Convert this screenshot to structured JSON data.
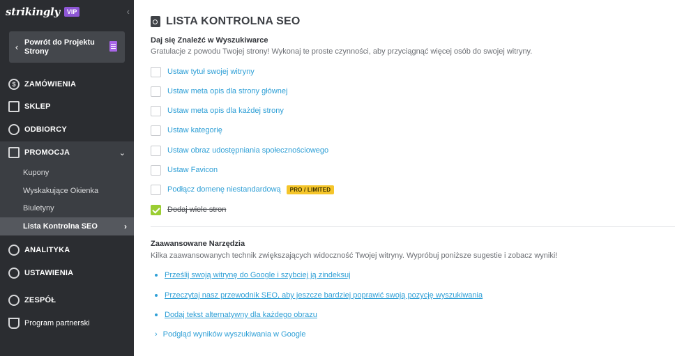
{
  "sidebar": {
    "logo": "strikingly",
    "vip": "VIP",
    "collapse_icon": "chevron-left-icon",
    "back_button": "Powrót do Projektu Strony",
    "nav": {
      "orders": "ZAMÓWIENIA",
      "store": "SKLEP",
      "audience": "ODBIORCY",
      "promotion": "PROMOCJA",
      "analytics": "ANALITYKA",
      "settings": "USTAWIENIA",
      "team": "ZESPÓŁ",
      "partner": "Program partnerski"
    },
    "sub": {
      "coupons": "Kupony",
      "popups": "Wyskakujące Okienka",
      "newsletters": "Biuletyny",
      "seo": "Lista Kontrolna SEO"
    }
  },
  "main": {
    "title": "LISTA KONTROLNA SEO",
    "section1": {
      "title": "Daj się Znaleźć w Wyszukiwarce",
      "desc": "Gratulacje z powodu Twojej strony! Wykonaj te proste czynności, aby przyciągnąć więcej osób do swojej witryny.",
      "items": [
        {
          "label": "Ustaw tytuł swojej witryny",
          "checked": false
        },
        {
          "label": "Ustaw meta opis dla strony głównej",
          "checked": false
        },
        {
          "label": "Ustaw meta opis dla każdej strony",
          "checked": false
        },
        {
          "label": "Ustaw kategorię",
          "checked": false
        },
        {
          "label": "Ustaw obraz udostępniania społecznościowego",
          "checked": false
        },
        {
          "label": "Ustaw Favicon",
          "checked": false
        },
        {
          "label": "Podłącz domenę niestandardową",
          "checked": false,
          "badge": "PRO / LIMITED"
        },
        {
          "label": "Dodaj wiele stron",
          "checked": true
        }
      ]
    },
    "section2": {
      "title": "Zaawansowane Narzędzia",
      "desc": "Kilka zaawansowanych technik zwiększających widoczność Twojej witryny. Wypróbuj poniższe sugestie i zobacz wyniki!",
      "links": [
        "Prześlij swoją witrynę do Google i szybciej ją zindeksuj",
        "Przeczytaj nasz przewodnik SEO, aby jeszcze bardziej poprawić swoją pozycję wyszukiwania",
        "Dodaj tekst alternatywny dla każdego obrazu"
      ],
      "expand_link": "Podgląd wyników wyszukiwania w Google"
    }
  },
  "colors": {
    "sidebar_bg": "#2b2d31",
    "link": "#2e9fd6",
    "check": "#9acd32",
    "badge": "#f5c52a",
    "vip": "#8e57d6"
  }
}
